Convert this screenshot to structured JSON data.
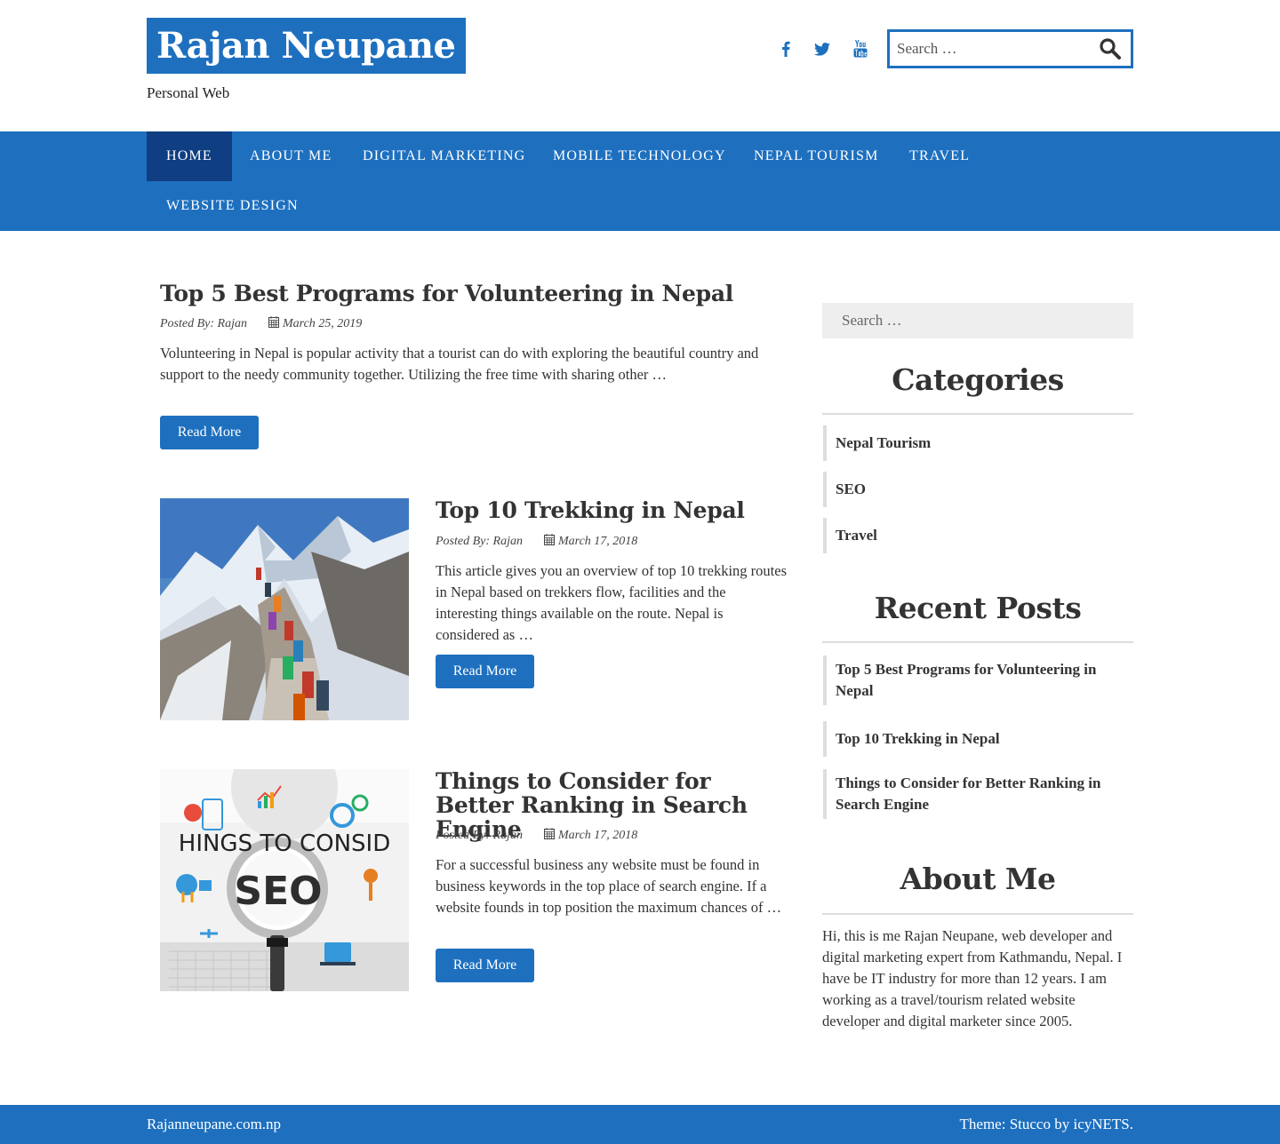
{
  "site": {
    "title": "Rajan Neupane",
    "tagline": "Personal Web",
    "search_placeholder": "Search …",
    "social": [
      "facebook-icon",
      "twitter-icon",
      "youtube-icon"
    ]
  },
  "nav": {
    "items": [
      "Home",
      "About Me",
      "Digital Marketing",
      "Mobile Technology",
      "Nepal Tourism",
      "Travel",
      "Website Design"
    ],
    "active": "Home"
  },
  "posts": [
    {
      "title": "Top 5 Best Programs for Volunteering in Nepal",
      "author_label": "Posted By: Rajan",
      "date": "March 25, 2019",
      "excerpt": "Volunteering in Nepal is popular activity that a tourist can do with exploring the beautiful country and support to the needy community together. Utilizing the free time with sharing other …",
      "read_more": "Read More"
    },
    {
      "title": "Top 10 Trekking in Nepal",
      "author_label": "Posted By: Rajan",
      "date": "March 17, 2018",
      "excerpt": "This article gives you an overview of top 10 trekking routes in Nepal based on trekkers flow, facilities and the interesting things available on the route.  Nepal is considered as …",
      "read_more": "Read More"
    },
    {
      "title": "Things to Consider for Better Ranking in Search Engine",
      "author_label": "Posted By: Rajan",
      "date": "March 17, 2018",
      "excerpt": "For a successful business any website must be found in business keywords in the top place of search engine. If a website founds in top position the maximum chances of …",
      "read_more": "Read More",
      "image_text": {
        "banner": "HINGS TO CONSID",
        "badge": "SEO"
      }
    }
  ],
  "sidebar": {
    "search_placeholder": "Search …",
    "categories_title": "Categories",
    "categories": [
      "Nepal Tourism",
      "SEO",
      "Travel"
    ],
    "recent_title": "Recent Posts",
    "recent": [
      "Top 5 Best Programs for Volunteering in Nepal",
      "Top 10 Trekking in Nepal",
      "Things to Consider for Better Ranking in Search Engine"
    ],
    "about_title": "About Me",
    "about_text": "Hi, this is me Rajan Neupane, web developer and digital marketing expert from Kathmandu, Nepal. I have be IT industry for more than 12 years. I am working as a travel/tourism related website developer and digital marketer since 2005."
  },
  "footer": {
    "site_link": "Rajanneupane.com.np",
    "credit": "Theme: Stucco by icyNETS."
  },
  "colors": {
    "primary": "#1e70bf",
    "nav_active": "#0f3e82",
    "rule": "#dddddd"
  }
}
